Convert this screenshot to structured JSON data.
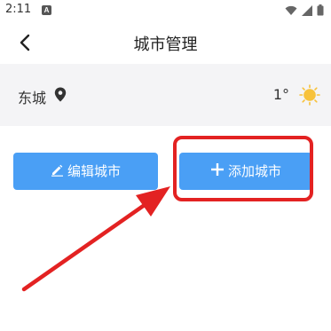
{
  "status_bar": {
    "time": "2:11",
    "app_icon_letter": "A",
    "icons": [
      "wifi-icon",
      "signal-icon",
      "battery-icon"
    ]
  },
  "header": {
    "title": "城市管理",
    "back_icon": "chevron-left-icon"
  },
  "city": {
    "name": "东城",
    "location_icon": "location-pin-icon",
    "temperature": "1°",
    "weather_icon": "sun-icon"
  },
  "actions": {
    "edit_label": "编辑城市",
    "edit_icon": "pencil-icon",
    "add_label": "添加城市",
    "add_icon": "plus-icon"
  },
  "colors": {
    "accent": "#4a9ff5",
    "annotation": "#e32222",
    "card_background": "#f4f4f6",
    "sun": "#f7c23c"
  }
}
